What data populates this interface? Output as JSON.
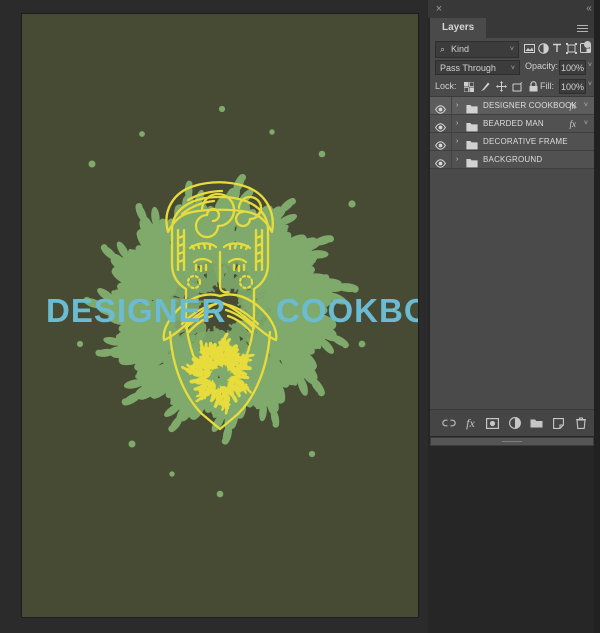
{
  "app": {
    "background_color": "#262626",
    "canvas_bg_color": "#474b34"
  },
  "document": {
    "artwork": {
      "title_left": "DESIGNER",
      "title_right": "COOKBOOK",
      "title_color": "#6bbcd2",
      "foliage_color": "#81ae6e",
      "line_art_color": "#e8dc3c",
      "background_color": "#474b34"
    }
  },
  "dock": {
    "close_icon": "×",
    "collapse_icon": "«"
  },
  "panel": {
    "tab_label": "Layers",
    "menu_icon": "hamburger-menu-icon",
    "filter": {
      "search_icon": "search-icon",
      "kind_label": "Kind",
      "chevron": "˅",
      "icons": [
        {
          "name": "filter-pixel-icon"
        },
        {
          "name": "filter-adjustment-icon"
        },
        {
          "name": "filter-type-icon"
        },
        {
          "name": "filter-shape-icon"
        },
        {
          "name": "filter-smart-object-icon"
        }
      ],
      "toggle_name": "filter-enable-toggle"
    },
    "blend": {
      "mode": "Pass Through",
      "chevron": "˅",
      "opacity_label": "Opacity:",
      "opacity_value": "100%"
    },
    "lock": {
      "label": "Lock:",
      "icons": [
        {
          "name": "lock-transparent-pixels-icon"
        },
        {
          "name": "lock-image-pixels-icon"
        },
        {
          "name": "lock-position-icon"
        },
        {
          "name": "lock-artboard-nesting-icon"
        },
        {
          "name": "lock-all-icon"
        }
      ],
      "fill_label": "Fill:",
      "fill_value": "100%"
    },
    "layers": [
      {
        "name": "DESIGNER COOKBOOK",
        "visible": true,
        "type": "group",
        "fx": true,
        "selected": true
      },
      {
        "name": "BEARDED MAN",
        "visible": true,
        "type": "group",
        "fx": true,
        "selected": false
      },
      {
        "name": "DECORATIVE FRAME",
        "visible": true,
        "type": "group",
        "fx": false,
        "selected": false
      },
      {
        "name": "BACKGROUND",
        "visible": true,
        "type": "group",
        "fx": false,
        "selected": false
      }
    ],
    "layer_fx_label": "fx",
    "layer_expand_chevron": "›",
    "tools": [
      {
        "name": "link-layers-icon"
      },
      {
        "name": "add-layer-style-icon",
        "label": "fx"
      },
      {
        "name": "add-layer-mask-icon"
      },
      {
        "name": "new-adjustment-layer-icon"
      },
      {
        "name": "new-group-icon"
      },
      {
        "name": "new-layer-icon"
      },
      {
        "name": "delete-layer-icon"
      }
    ]
  }
}
